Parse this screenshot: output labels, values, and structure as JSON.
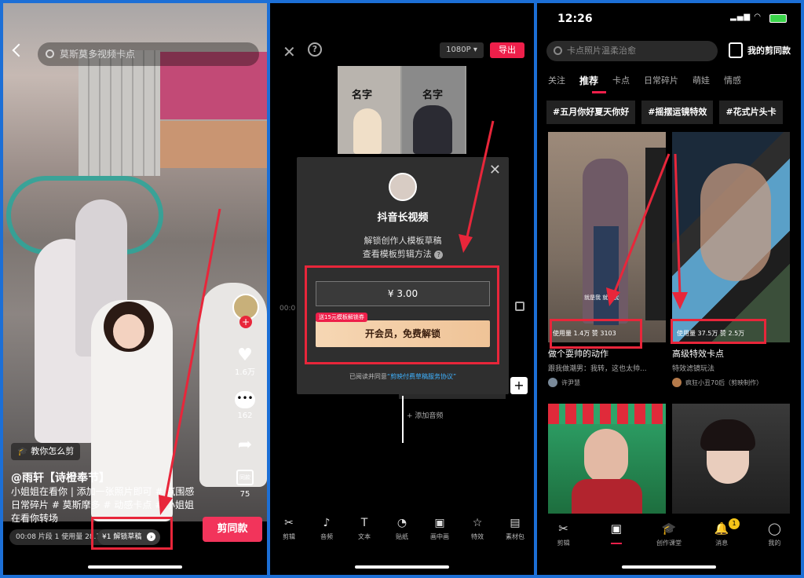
{
  "panel1": {
    "search_placeholder": "莫斯莫多视频卡点",
    "teach_badge": "教你怎么剪",
    "author": "@雨轩【诗橙奉节】",
    "description": "小姐姐在看你 | 添加一张照片即可 # 氛围感 日常碎片 # 莫斯摩多 # 动感卡点 # 小姐姐 在看你转场",
    "likes": "1.6万",
    "comments": "162",
    "share_label": "同款",
    "share_count": "75",
    "info_bar": "00:08 片段 1 使用量 28.7万",
    "unlock_chip": "¥1 解锁草稿",
    "cta_button": "剪同款"
  },
  "panel2": {
    "resolution": "1080P ▾",
    "export": "导出",
    "preview_label_left": "名字",
    "preview_label_right": "名字",
    "modal_title": "抖音长视频",
    "modal_desc_line1": "解锁创作人模板草稿",
    "modal_desc_line2": "查看模板剪辑方法",
    "price": "¥ 3.00",
    "vip_badge": "送15元模板解锁券",
    "vip_button": "开会员，免费解锁",
    "agreement_prefix": "已阅读并同意",
    "agreement_link": "“剪映付费草稿服务协议”",
    "timeline_time": "00:0",
    "add_audio": "+ 添加音频",
    "tools": [
      "剪辑",
      "音频",
      "文本",
      "贴纸",
      "画中画",
      "特效",
      "素材包"
    ]
  },
  "panel3": {
    "time": "12:26",
    "search_placeholder": "卡点照片温柔治愈",
    "my_templates": "我的剪同款",
    "tabs": [
      "关注",
      "推荐",
      "卡点",
      "日常碎片",
      "萌娃",
      "情感"
    ],
    "active_tab": "推荐",
    "topics": [
      "#五月你好夏天你好",
      "#摇摆运镜特效",
      "#花式片头卡"
    ],
    "cards": [
      {
        "stats": "使用量 1.4万 赞 3103",
        "title": "做个耍帅的动作",
        "subtitle": "跟我做潮男：我转，这也太帅...",
        "user": "许尹慧",
        "caption": "就是我 就是我"
      },
      {
        "stats": "使用量 37.5万 赞 2.5万",
        "title": "高级特效卡点",
        "subtitle": "特效滤镜玩法",
        "user": "疯狂小丑70后（剪映制作）"
      }
    ],
    "nav": [
      "剪辑",
      "剪同款",
      "创作课堂",
      "消息",
      "我的"
    ],
    "message_badge": "1"
  },
  "colors": {
    "accent": "#f2345b",
    "annotation_red": "#e8263a",
    "background": "#1c6fd6"
  }
}
